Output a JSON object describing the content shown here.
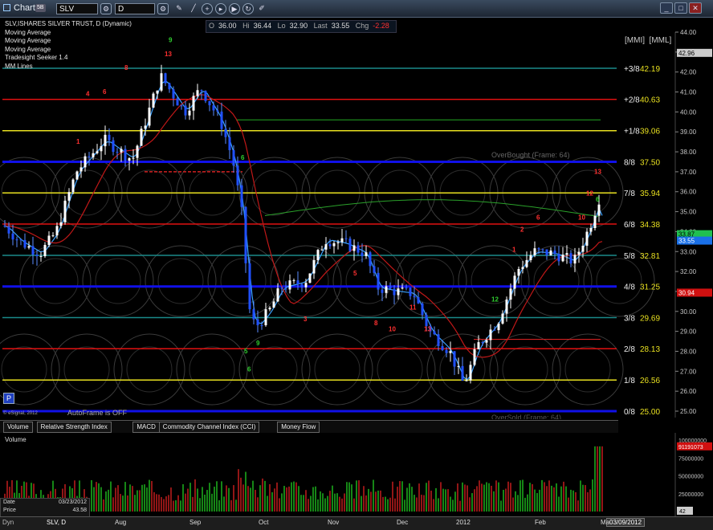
{
  "window": {
    "title": "Chart",
    "badge": "5B",
    "symbol": "SLV",
    "interval": "D"
  },
  "ohlc": {
    "o_label": "O",
    "o": "36.00",
    "h_label": "Hi",
    "h": "36.44",
    "l_label": "Lo",
    "l": "32.90",
    "last_label": "Last",
    "last": "33.55",
    "chg_label": "Chg",
    "chg": "-2.28"
  },
  "legend": [
    "SLV,ISHARES SILVER TRUST, D (Dynamic)",
    "Moving Average",
    "Moving Average",
    "Moving Average",
    "Tradesight Seeker 1.4",
    "MM Lines"
  ],
  "mm_header": "[MMI]  [MML]",
  "chart_data": {
    "type": "candlestick",
    "title": "SLV,ISHARES SILVER TRUST, D (Dynamic)",
    "ylim": [
      25.0,
      44.0
    ],
    "y_ticks": [
      25,
      26,
      27,
      28,
      29,
      30,
      31,
      32,
      33,
      34,
      35,
      36,
      37,
      38,
      39,
      40,
      41,
      42,
      43,
      44
    ],
    "x_labels": [
      "Aug",
      "Sep",
      "Oct",
      "Nov",
      "Dec",
      "2012",
      "Feb",
      "Ma"
    ],
    "x_ticks": [
      0.0,
      1.0,
      2.0,
      3.0,
      4.0,
      5.0,
      6.0,
      7.0
    ],
    "mm_lines": [
      {
        "label": "+3/8",
        "value": 42.19,
        "color": "#1a8a8a"
      },
      {
        "label": "+2/8",
        "value": 40.63,
        "color": "#e01010"
      },
      {
        "label": "+1/8",
        "value": 39.06,
        "color": "#e8e020"
      },
      {
        "label": "8/8",
        "value": 37.5,
        "color": "#1010e8"
      },
      {
        "label": "7/8",
        "value": 35.94,
        "color": "#e8e020"
      },
      {
        "label": "6/8",
        "value": 34.38,
        "color": "#e01010"
      },
      {
        "label": "5/8",
        "value": 32.81,
        "color": "#1a8a8a"
      },
      {
        "label": "4/8",
        "value": 31.25,
        "color": "#1010e8"
      },
      {
        "label": "3/8",
        "value": 29.69,
        "color": "#1a8a8a"
      },
      {
        "label": "2/8",
        "value": 28.13,
        "color": "#e01010"
      },
      {
        "label": "1/8",
        "value": 26.56,
        "color": "#e8e020"
      },
      {
        "label": "0/8",
        "value": 25.0,
        "color": "#1010e8"
      }
    ],
    "price_tags": [
      {
        "value": 42.96,
        "text": "42.96",
        "bg": "#cccccc",
        "fg": "#000000"
      },
      {
        "value": 33.87,
        "text": "33.87",
        "bg": "#20c050",
        "fg": "#000000"
      },
      {
        "value": 33.55,
        "text": "33.55",
        "bg": "#1a70e8",
        "fg": "#ffffff"
      },
      {
        "value": 30.94,
        "text": "30.94",
        "bg": "#d01010",
        "fg": "#ffffff"
      }
    ],
    "annotations": {
      "overbought": "OverBought (Frame: 64)",
      "oversold": "OverSold (Frame: 64)",
      "autoframe": "AutoFrame is OFF",
      "copyright": "© eSignal, 2012"
    },
    "volume": {
      "label": "Volume",
      "ticks": [
        "100000000",
        "75000000",
        "50000000",
        "25000000"
      ],
      "last_tag": "91191073",
      "bottom_tag": "42"
    }
  },
  "tabs": [
    "Volume",
    "Relative Strength Index",
    "MACD",
    "Commodity Channel Index (CCI)",
    "Money Flow"
  ],
  "datebox": {
    "date_label": "Date",
    "date": "03/23/2012",
    "price_label": "Price",
    "price": "43.58"
  },
  "bottom": {
    "dyn": "Dyn",
    "sym": "SLV, D",
    "date_tag": "03/09/2012"
  },
  "p_button": "P"
}
